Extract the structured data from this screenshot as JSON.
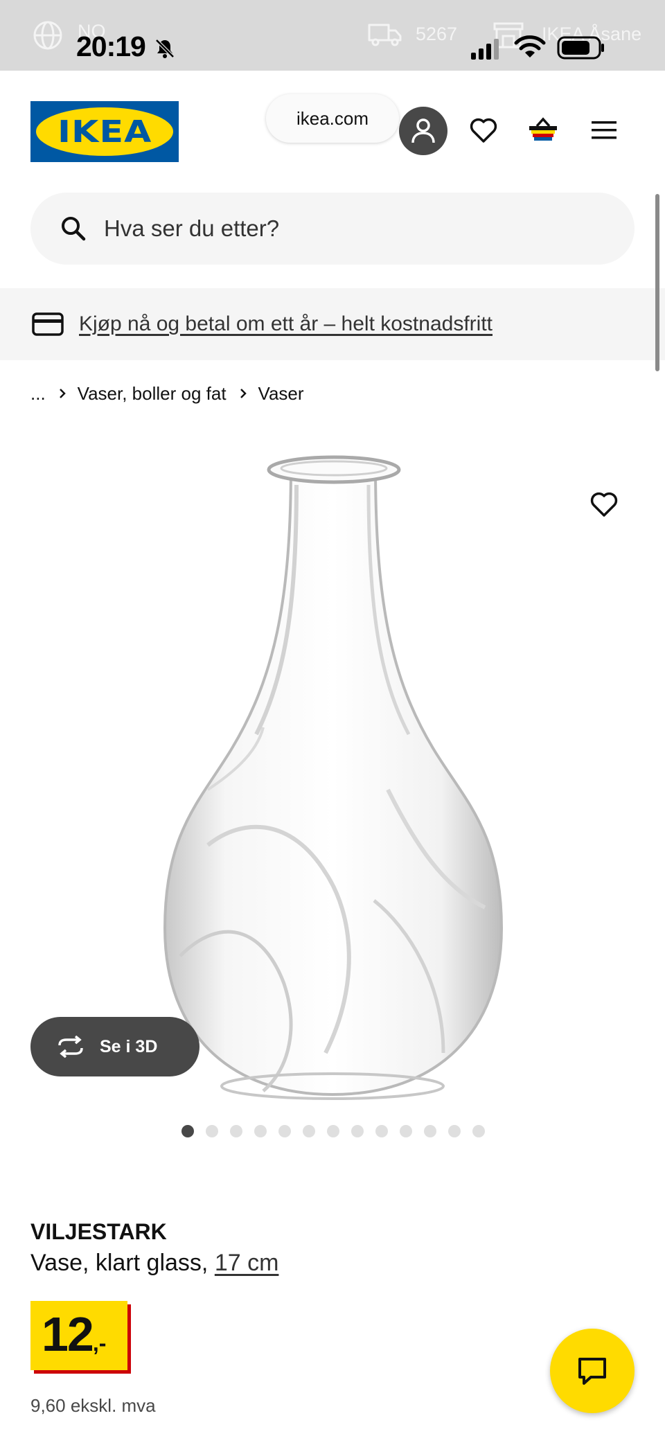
{
  "status_bar": {
    "region_code": "NO",
    "time": "20:19",
    "delivery_postcode": "5267",
    "store_name": "IKEA Åsane"
  },
  "header": {
    "logo_text": "IKEA",
    "url": "ikea.com"
  },
  "search": {
    "placeholder": "Hva ser du etter?"
  },
  "promo": {
    "text": "Kjøp nå og betal om ett år – helt kostnadsfritt"
  },
  "breadcrumb": {
    "ellipsis": "...",
    "items": [
      "Vaser, boller og fat",
      "Vaser"
    ]
  },
  "product": {
    "name": "VILJESTARK",
    "description": "Vase, klart glass,",
    "size": "17 cm",
    "price_integer": "12",
    "price_suffix": ",-",
    "price_ex_vat": "9,60 ekskl. mva",
    "view_3d_label": "Se i 3D",
    "image_count": 13,
    "active_image_index": 0
  },
  "colors": {
    "ikea_yellow": "#ffdb00",
    "ikea_blue": "#0058a3",
    "price_shadow_red": "#cc0008",
    "dark_gray": "#484848"
  },
  "icons": {
    "status": [
      "globe-icon",
      "bell-slash-icon",
      "truck-icon",
      "store-icon",
      "cellular-signal-icon",
      "wifi-icon",
      "battery-icon"
    ],
    "header": [
      "user-icon",
      "heart-icon",
      "shopping-bag-icon",
      "hamburger-menu-icon"
    ],
    "other": [
      "search-icon",
      "credit-card-icon",
      "chevron-right-icon",
      "rotate-3d-icon",
      "chat-icon"
    ]
  }
}
